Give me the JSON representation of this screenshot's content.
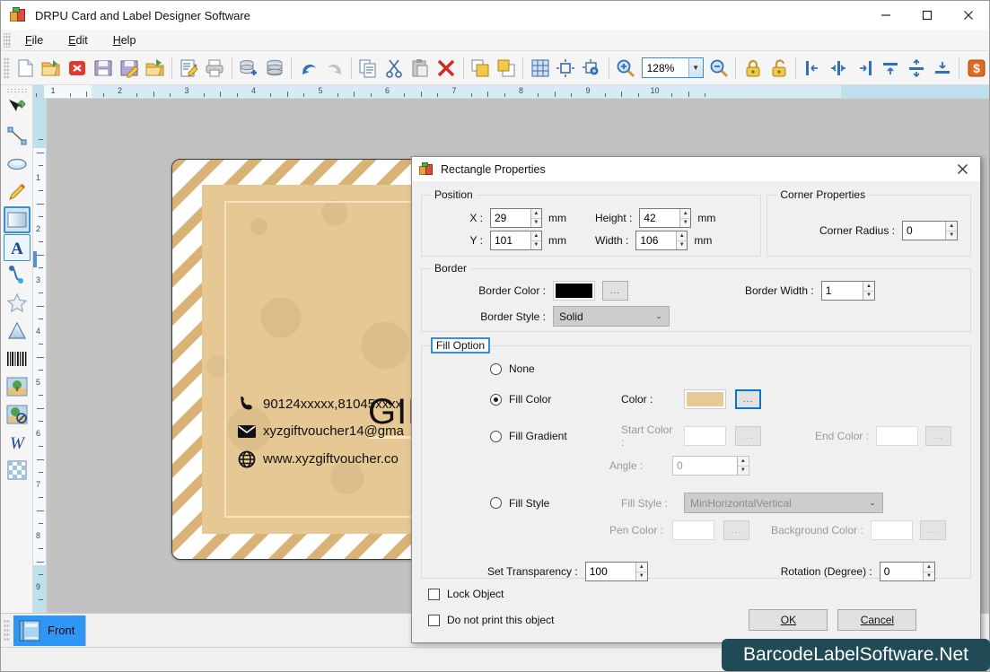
{
  "window": {
    "title": "DRPU Card and Label Designer Software",
    "icon": "app-boxes-icon",
    "minimize": "—",
    "maximize": "☐",
    "close": "✕"
  },
  "menubar": {
    "items": [
      {
        "label": "File",
        "accel": "F"
      },
      {
        "label": "Edit",
        "accel": "E"
      },
      {
        "label": "Help",
        "accel": "H"
      }
    ]
  },
  "toolbar": {
    "zoom_value": "128%",
    "buttons": [
      {
        "name": "new-document-button",
        "tip": "New"
      },
      {
        "name": "open-document-button",
        "tip": "Open"
      },
      {
        "name": "close-document-button",
        "tip": "Close"
      },
      {
        "name": "save-button",
        "tip": "Save"
      },
      {
        "name": "save-as-button",
        "tip": "Save As"
      },
      {
        "name": "open-recent-button",
        "tip": "Open Recent"
      },
      {
        "name": "edit-document-button",
        "tip": "Edit"
      },
      {
        "name": "print-button",
        "tip": "Print"
      },
      {
        "name": "add-database-button",
        "tip": "Add Database"
      },
      {
        "name": "database-button",
        "tip": "Database"
      },
      {
        "name": "undo-button",
        "tip": "Undo"
      },
      {
        "name": "redo-button",
        "tip": "Redo"
      },
      {
        "name": "copy-button",
        "tip": "Copy"
      },
      {
        "name": "cut-button",
        "tip": "Cut"
      },
      {
        "name": "paste-button",
        "tip": "Paste"
      },
      {
        "name": "delete-button",
        "tip": "Delete"
      },
      {
        "name": "bring-to-front-button",
        "tip": "Bring to Front"
      },
      {
        "name": "send-to-back-button",
        "tip": "Send to Back"
      },
      {
        "name": "grid-button",
        "tip": "Grid"
      },
      {
        "name": "align-center-button",
        "tip": "Center"
      },
      {
        "name": "settings-align-button",
        "tip": "Align Settings"
      },
      {
        "name": "zoom-in-button",
        "tip": "Zoom In"
      },
      {
        "name": "zoom-out-button",
        "tip": "Zoom Out"
      },
      {
        "name": "lock-button",
        "tip": "Lock"
      },
      {
        "name": "unlock-button",
        "tip": "Unlock"
      },
      {
        "name": "align-left-button",
        "tip": "Align Left"
      },
      {
        "name": "align-horizontal-center-button",
        "tip": "Align Horizontal Center"
      },
      {
        "name": "align-right-button",
        "tip": "Align Right"
      },
      {
        "name": "align-top-button",
        "tip": "Align Top"
      },
      {
        "name": "align-vertical-center-button",
        "tip": "Align Vertical Center"
      },
      {
        "name": "align-bottom-button",
        "tip": "Align Bottom"
      },
      {
        "name": "currency-button",
        "tip": "Currency"
      }
    ]
  },
  "left_palette": {
    "tools": [
      {
        "name": "select-tool",
        "label": "Select"
      },
      {
        "name": "line-tool",
        "label": "Line"
      },
      {
        "name": "ellipse-tool",
        "label": "Ellipse"
      },
      {
        "name": "pencil-tool",
        "label": "Pencil"
      },
      {
        "name": "rectangle-tool",
        "label": "Rectangle",
        "selected": true
      },
      {
        "name": "text-tool",
        "label": "Text",
        "active": true
      },
      {
        "name": "curve-tool",
        "label": "Curve"
      },
      {
        "name": "star-tool",
        "label": "Star"
      },
      {
        "name": "triangle-tool",
        "label": "Triangle"
      },
      {
        "name": "barcode-tool",
        "label": "Barcode"
      },
      {
        "name": "image-tool",
        "label": "Image"
      },
      {
        "name": "watermark-image-tool",
        "label": "Watermark Image"
      },
      {
        "name": "word-art-tool",
        "label": "Word Art"
      },
      {
        "name": "pattern-tool",
        "label": "Pattern"
      }
    ]
  },
  "rulers": {
    "horizontal_labels": [
      "1",
      "2",
      "3",
      "4",
      "5",
      "6",
      "7",
      "8",
      "9",
      "10"
    ],
    "vertical_labels": [
      "1",
      "2",
      "3",
      "4",
      "5",
      "6",
      "7",
      "8",
      "9"
    ]
  },
  "card": {
    "title": "GIFT",
    "contacts": [
      {
        "icon": "phone-icon",
        "glyph": "☎",
        "text": "90124xxxxx,81045xxxx"
      },
      {
        "icon": "envelope-icon",
        "glyph": "✉",
        "text": "xyzgiftvoucher14@gma"
      },
      {
        "icon": "globe-icon",
        "glyph": "ἱ0",
        "text": "www.xyzgiftvoucher.co"
      }
    ],
    "fill_hex": "#e5c894",
    "border_hex": "#d9b276"
  },
  "bottom": {
    "tab_label": "Front",
    "tab_icon": "card-front-icon",
    "tab_color": "#2f96f5"
  },
  "watermark": {
    "text": "BarcodeLabelSoftware.Net",
    "bg_hex": "#1f4a56"
  },
  "dialog": {
    "title": "Rectangle Properties",
    "icon": "app-boxes-icon",
    "close_glyph": "✕",
    "position_group": {
      "legend": "Position",
      "x_label": "X :",
      "x_value": "29",
      "x_unit": "mm",
      "y_label": "Y :",
      "y_value": "101",
      "y_unit": "mm",
      "height_label": "Height :",
      "height_value": "42",
      "height_unit": "mm",
      "width_label": "Width :",
      "width_value": "106",
      "width_unit": "mm"
    },
    "corner_group": {
      "legend": "Corner Properties",
      "radius_label": "Corner Radius :",
      "radius_value": "0"
    },
    "border_group": {
      "legend": "Border",
      "color_label": "Border Color :",
      "color_hex": "#000000",
      "color_browse": "...",
      "style_label": "Border Style :",
      "style_value": "Solid",
      "width_label": "Border Width :",
      "width_value": "1"
    },
    "fill_group": {
      "legend": "Fill Option",
      "none_label": "None",
      "fill_color_label": "Fill Color",
      "color_label": "Color :",
      "color_hex": "#e8c894",
      "color_browse": "...",
      "fill_gradient_label": "Fill Gradient",
      "start_color_label": "Start Color :",
      "start_color_hex": "#ffffff",
      "start_browse": "...",
      "end_color_label": "End Color :",
      "end_color_hex": "#ffffff",
      "end_browse": "...",
      "angle_label": "Angle :",
      "angle_value": "0",
      "fill_style_label": "Fill Style",
      "fill_style_field_label": "Fill Style :",
      "fill_style_value": "MinHorizontalVertical",
      "pen_color_label": "Pen Color :",
      "pen_color_hex": "#ffffff",
      "pen_browse": "...",
      "background_color_label": "Background Color :",
      "background_color_hex": "#ffffff",
      "background_browse": "...",
      "transparency_label": "Set Transparency :",
      "transparency_value": "100",
      "rotation_label": "Rotation (Degree) :",
      "rotation_value": "0"
    },
    "lock_object_label": "Lock Object",
    "do_not_print_label": "Do not print this object",
    "ok_label": "OK",
    "cancel_label": "Cancel"
  }
}
